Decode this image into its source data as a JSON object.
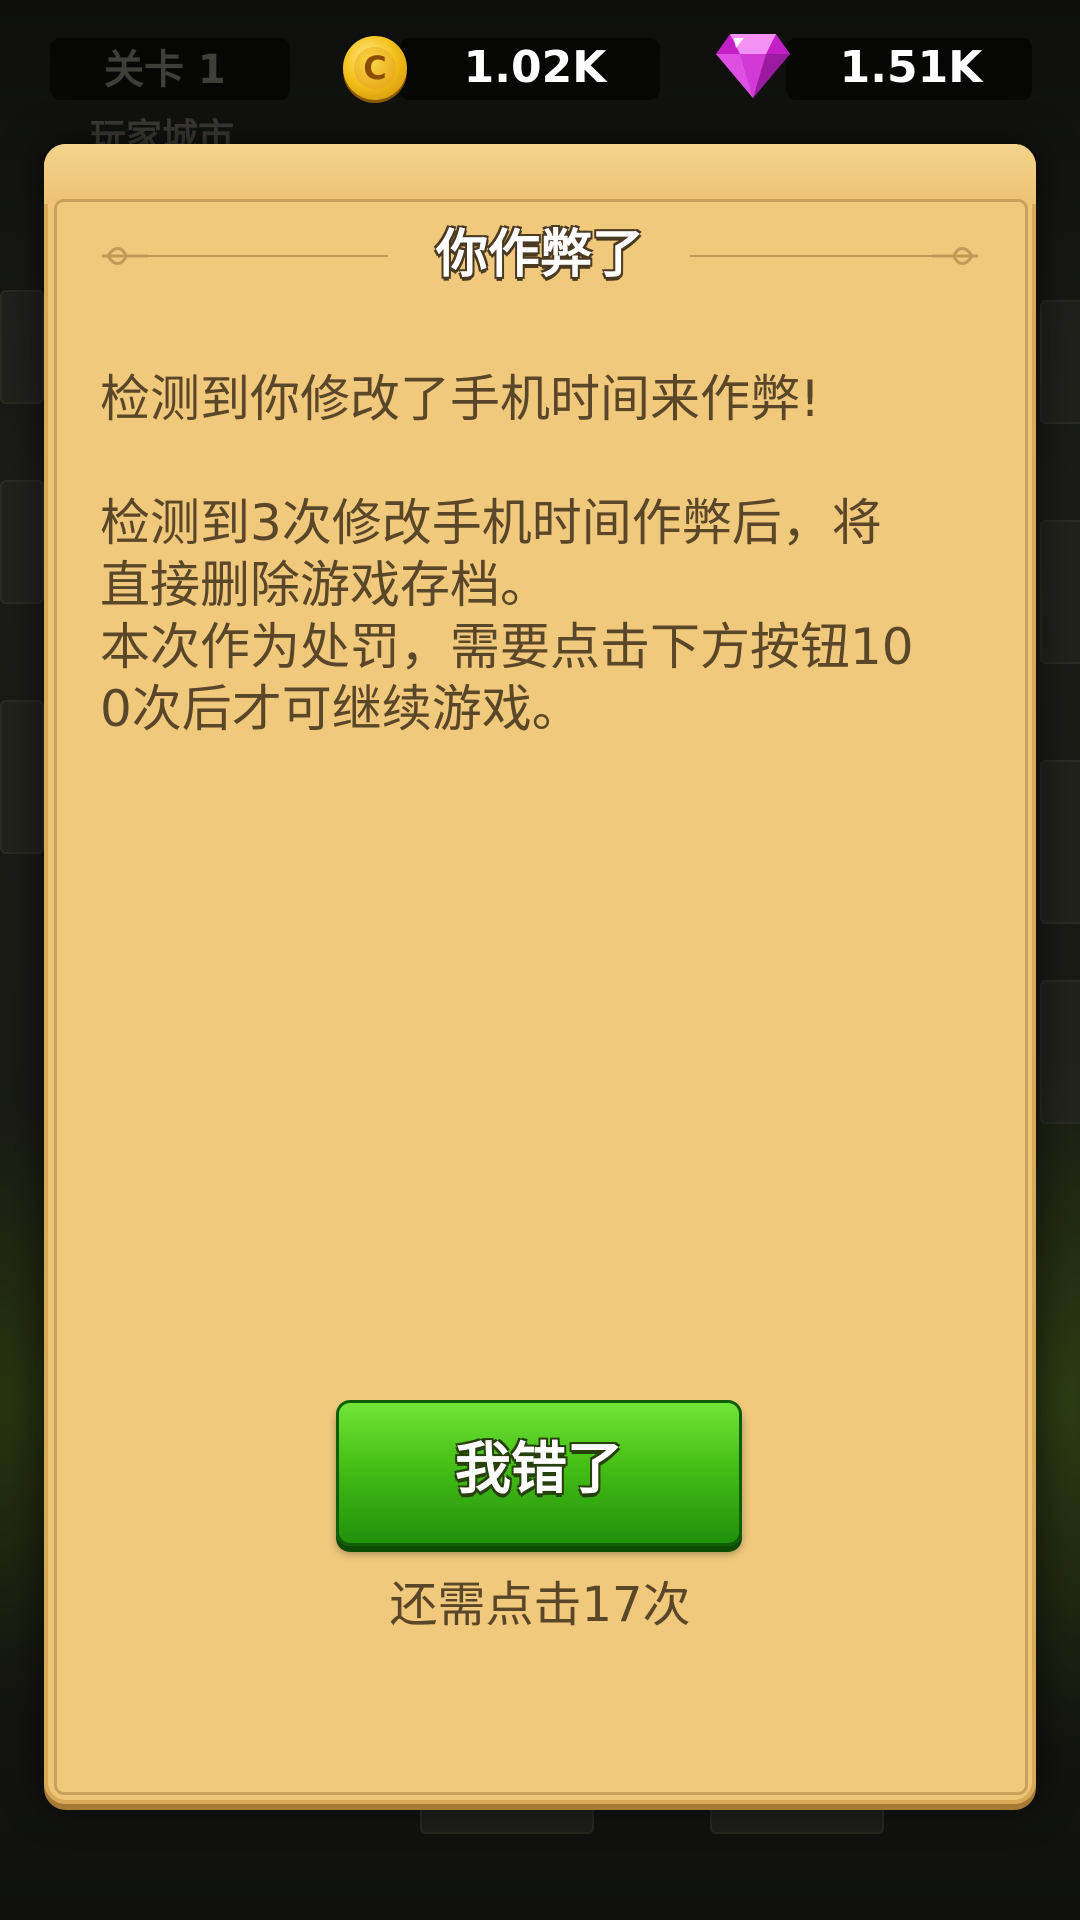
{
  "hud": {
    "level_label": "关卡 1",
    "coins": "1.02K",
    "gems": "1.51K",
    "background_label": "玩家城市"
  },
  "icons": {
    "coin": "coin-icon",
    "gem": "diamond-icon"
  },
  "dialog": {
    "title": "你作弊了",
    "message1": "检测到你修改了手机时间来作弊!",
    "message2": "检测到3次修改手机时间作弊后，将\n直接删除游戏存档。\n本次作为处罚，需要点击下方按钮10\n0次后才可继续游戏。",
    "button_label": "我错了",
    "remaining_text": "还需点击17次"
  },
  "colors": {
    "panel": "#eec67a",
    "text": "#5a4628",
    "button_green": "#45bf16"
  }
}
